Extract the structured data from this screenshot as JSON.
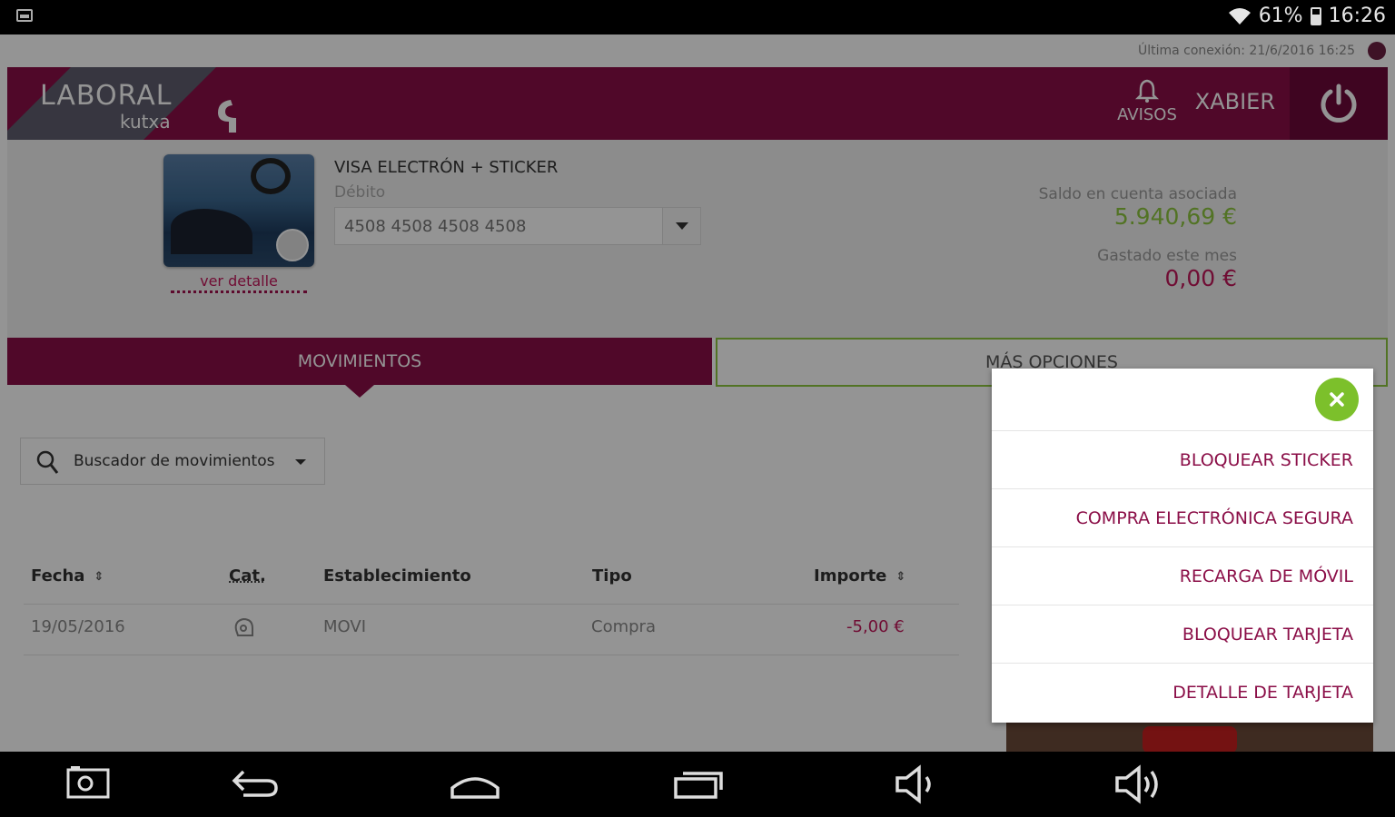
{
  "status_bar": {
    "battery": "61%",
    "time": "16:26"
  },
  "header": {
    "last_connection": "Última conexión: 21/6/2016 16:25",
    "logo_line1": "LABORAL",
    "logo_line2": "kutxa",
    "alerts_label": "AVISOS",
    "user_name": "XABIER"
  },
  "card": {
    "name": "VISA ELECTRÓN + STICKER",
    "type": "Débito",
    "number": "4508 4508 4508 4508",
    "details_link": "ver detalle",
    "balance_label": "Saldo en cuenta asociada",
    "balance_value": "5.940,69 €",
    "spent_label": "Gastado este mes",
    "spent_value": "0,00 €"
  },
  "tabs": {
    "movements": "MOVIMIENTOS",
    "more_options": "MÁS OPCIONES"
  },
  "search": {
    "label": "Buscador de movimientos"
  },
  "table": {
    "headers": {
      "date": "Fecha",
      "category": "Cat.",
      "merchant": "Establecimiento",
      "type": "Tipo",
      "amount": "Importe"
    },
    "rows": [
      {
        "date": "19/05/2016",
        "merchant": "MOVI",
        "type": "Compra",
        "amount": "-5,00 €"
      }
    ]
  },
  "popup": {
    "items": [
      "BLOQUEAR STICKER",
      "COMPRA ELECTRÓNICA SEGURA",
      "RECARGA DE MÓVIL",
      "BLOQUEAR TARJETA",
      "DETALLE DE TARJETA"
    ]
  },
  "colors": {
    "brand": "#8b0f48",
    "accent_green": "#8dc63f",
    "negative": "#c2185b"
  },
  "icons": [
    "wifi-icon",
    "battery-icon",
    "bell-icon",
    "power-icon",
    "search-icon",
    "category-icon",
    "close-icon",
    "screenshot-icon",
    "back-icon",
    "home-icon",
    "recents-icon",
    "volume-down-icon",
    "volume-up-icon"
  ]
}
